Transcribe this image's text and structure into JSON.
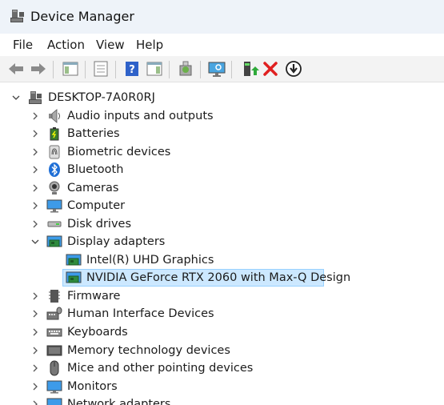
{
  "window": {
    "title": "Device Manager"
  },
  "menu": {
    "items": [
      "File",
      "Action",
      "View",
      "Help"
    ]
  },
  "toolbar": {
    "buttons": [
      "back-icon",
      "forward-icon",
      "show-hide-tree-icon",
      "properties-icon",
      "help-icon",
      "action-pane-icon",
      "scan-hardware-icon",
      "monitor-search-icon",
      "update-driver-icon",
      "uninstall-device-icon",
      "disable-device-icon"
    ]
  },
  "tree": {
    "root": "DESKTOP-7A0R0RJ",
    "items": [
      {
        "label": "Audio inputs and outputs",
        "icon": "speaker-icon",
        "expanded": false
      },
      {
        "label": "Batteries",
        "icon": "battery-icon",
        "expanded": false
      },
      {
        "label": "Biometric devices",
        "icon": "fingerprint-icon",
        "expanded": false
      },
      {
        "label": "Bluetooth",
        "icon": "bluetooth-icon",
        "expanded": false
      },
      {
        "label": "Cameras",
        "icon": "camera-icon",
        "expanded": false
      },
      {
        "label": "Computer",
        "icon": "computer-icon",
        "expanded": false
      },
      {
        "label": "Disk drives",
        "icon": "disk-icon",
        "expanded": false
      },
      {
        "label": "Display adapters",
        "icon": "display-adapter-icon",
        "expanded": true,
        "children": [
          {
            "label": "Intel(R) UHD Graphics",
            "icon": "display-adapter-icon",
            "selected": false
          },
          {
            "label": "NVIDIA GeForce RTX 2060 with Max-Q Design",
            "icon": "display-adapter-icon",
            "selected": true
          }
        ]
      },
      {
        "label": "Firmware",
        "icon": "firmware-icon",
        "expanded": false
      },
      {
        "label": "Human Interface Devices",
        "icon": "hid-icon",
        "expanded": false
      },
      {
        "label": "Keyboards",
        "icon": "keyboard-icon",
        "expanded": false
      },
      {
        "label": "Memory technology devices",
        "icon": "memory-icon",
        "expanded": false
      },
      {
        "label": "Mice and other pointing devices",
        "icon": "mouse-icon",
        "expanded": false
      },
      {
        "label": "Monitors",
        "icon": "monitor-icon",
        "expanded": false
      },
      {
        "label": "Network adapters",
        "icon": "network-icon",
        "expanded": false
      }
    ]
  },
  "colors": {
    "selection": "#cce8ff",
    "selection_border": "#99d1ff",
    "titlebar": "#eef3f9",
    "toolbar": "#f3f3f3"
  }
}
